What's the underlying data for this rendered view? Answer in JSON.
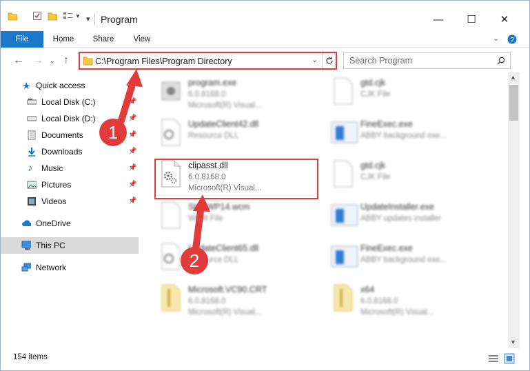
{
  "window": {
    "title": "Program",
    "controls": {
      "minimize": "—",
      "maximize": "☐",
      "close": "✕"
    }
  },
  "ribbon": {
    "tabs": [
      "File",
      "Home",
      "Share",
      "View"
    ]
  },
  "address_bar": {
    "path": "C:\\Program Files\\Program Directory"
  },
  "search": {
    "placeholder": "Search Program"
  },
  "sidebar": {
    "quick_access": "Quick access",
    "items": [
      {
        "label": "Local Disk (C:)",
        "icon": "drive-icon"
      },
      {
        "label": "Local Disk (D:)",
        "icon": "drive-icon"
      },
      {
        "label": "Documents",
        "icon": "documents-icon"
      },
      {
        "label": "Downloads",
        "icon": "downloads-icon"
      },
      {
        "label": "Music",
        "icon": "music-icon"
      },
      {
        "label": "Pictures",
        "icon": "pictures-icon"
      },
      {
        "label": "Videos",
        "icon": "videos-icon"
      }
    ],
    "onedrive": "OneDrive",
    "this_pc": "This PC",
    "network": "Network"
  },
  "files": [
    {
      "name": "program.exe",
      "line1": "6.0.8168.0",
      "line2": "Microsoft(R) Visual...",
      "icon": "exe-icon",
      "blurred": true
    },
    {
      "name": "gtd.cjk",
      "line1": "CJK File",
      "line2": "",
      "icon": "blank-file-icon",
      "blurred": true
    },
    {
      "name": "UpdateClient42.dll",
      "line1": "Resource DLL",
      "line2": "",
      "icon": "dll-icon",
      "blurred": true
    },
    {
      "name": "FineExec.exe",
      "line1": "ABBY background exe...",
      "line2": "",
      "icon": "app-icon",
      "blurred": true
    },
    {
      "name": "clipasst.dll",
      "line1": "6.0.8168.0",
      "line2": "Microsoft(R) Visual...",
      "icon": "dll-icon",
      "blurred": false
    },
    {
      "name": "gtd.cjk",
      "line1": "CJK File",
      "line2": "",
      "icon": "blank-file-icon",
      "blurred": true
    },
    {
      "name": "StartWP14.wcm",
      "line1": "WCM File",
      "line2": "",
      "icon": "blank-file-icon",
      "blurred": true
    },
    {
      "name": "UpdateInstaller.exe",
      "line1": "ABBY updates installer",
      "line2": "",
      "icon": "app-icon",
      "blurred": true
    },
    {
      "name": "UpdateClient65.dll",
      "line1": "Resource DLL",
      "line2": "",
      "icon": "dll-icon",
      "blurred": true
    },
    {
      "name": "FineExec.exe",
      "line1": "ABBY background exe...",
      "line2": "",
      "icon": "app-icon",
      "blurred": true
    },
    {
      "name": "Microsoft.VC90.CRT",
      "line1": "6.0.8168.0",
      "line2": "Microsoft(R) Visual...",
      "icon": "folder-zip-icon",
      "blurred": true
    },
    {
      "name": "x64",
      "line1": "6.0.8168.0",
      "line2": "Microsoft(R) Visual...",
      "icon": "folder-zip-icon",
      "blurred": true
    }
  ],
  "status": {
    "item_count": "154 items"
  },
  "annotations": {
    "step1": "1",
    "step2": "2"
  },
  "colors": {
    "accent": "#1979ca",
    "highlight": "#e23b3b"
  }
}
